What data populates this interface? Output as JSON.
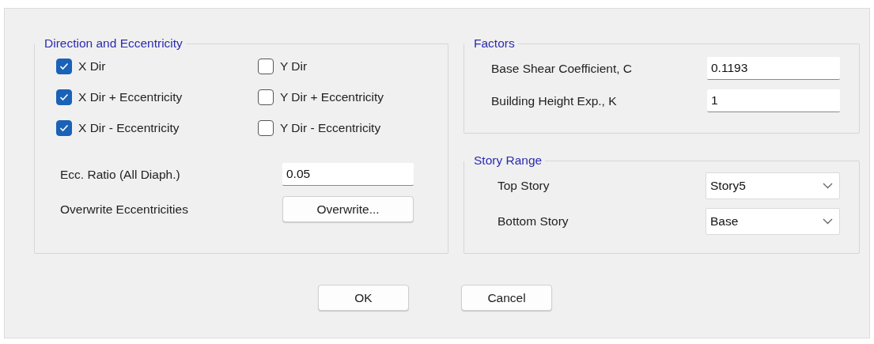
{
  "direction_group": {
    "title": "Direction and Eccentricity",
    "checkboxes": [
      {
        "label": "X Dir",
        "checked": true
      },
      {
        "label": "Y Dir",
        "checked": false
      },
      {
        "label": "X Dir + Eccentricity",
        "checked": true
      },
      {
        "label": "Y Dir + Eccentricity",
        "checked": false
      },
      {
        "label": "X Dir - Eccentricity",
        "checked": true
      },
      {
        "label": "Y Dir - Eccentricity",
        "checked": false
      }
    ],
    "rows": [
      {
        "kind": "field",
        "label": "Ecc. Ratio (All Diaph.)",
        "value": "0.05"
      },
      {
        "kind": "button",
        "label": "Overwrite Eccentricities",
        "button": "Overwrite..."
      }
    ]
  },
  "factors_group": {
    "title": "Factors",
    "rows": [
      {
        "kind": "field",
        "label": "Base Shear Coefficient, C",
        "value": "0.1193"
      },
      {
        "kind": "field",
        "label": "Building Height Exp., K",
        "value": "1"
      }
    ]
  },
  "story_range_group": {
    "title": "Story Range",
    "rows": [
      {
        "kind": "dropdown",
        "label": "Top Story",
        "value": "Story5"
      },
      {
        "kind": "dropdown",
        "label": "Bottom Story",
        "value": "Base"
      }
    ]
  },
  "buttons": [
    "OK",
    "Cancel"
  ]
}
